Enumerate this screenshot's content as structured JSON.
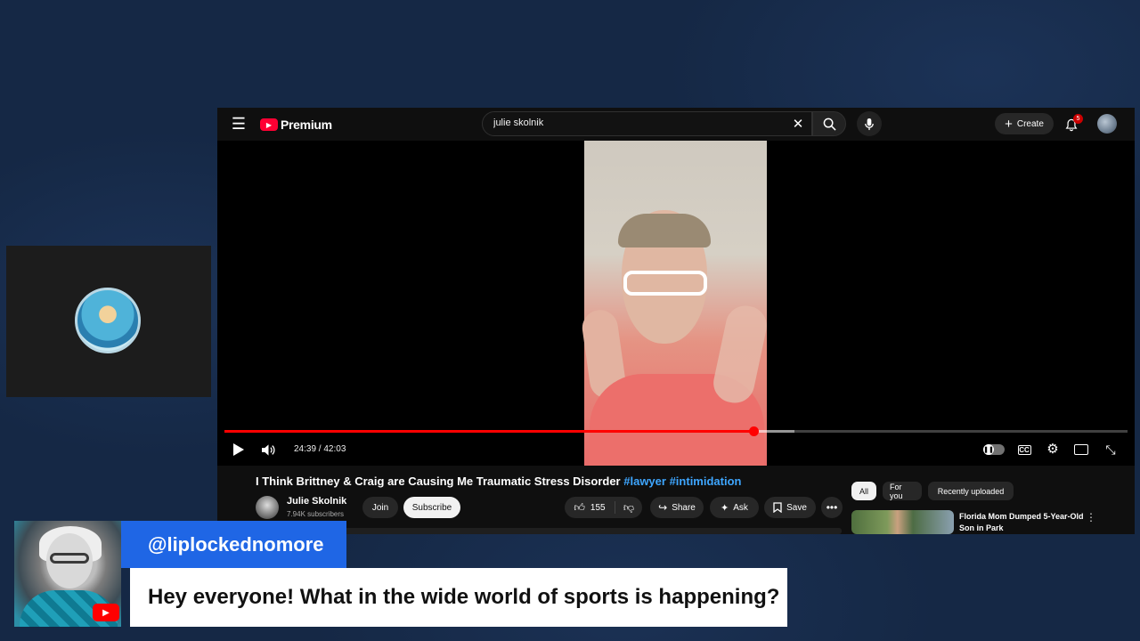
{
  "webcam_panel": {
    "avatar_icon": "channel-logo-avatar"
  },
  "youtube": {
    "logo_text": "Premium",
    "search": {
      "value": "julie skolnik",
      "placeholder": "Search"
    },
    "create_label": "Create",
    "notification_count": "5",
    "player": {
      "time_current": "24:39",
      "time_total": "42:03",
      "time_display": "24:39 / 42:03",
      "progress_fraction": 0.586,
      "buffer_fraction": 0.631
    },
    "video": {
      "title_main": "I Think Brittney & Craig are Causing Me Traumatic Stress Disorder",
      "tag1": "#lawyer",
      "tag2": "#intimidation",
      "channel_name": "Julie Skolnik",
      "subscribers": "7.94K subscribers",
      "join_label": "Join",
      "subscribe_label": "Subscribe",
      "like_count": "155",
      "share_label": "Share",
      "ask_label": "Ask",
      "save_label": "Save"
    },
    "chips": [
      "All",
      "For you",
      "Recently uploaded"
    ],
    "recommendation": {
      "title": "Florida Mom Dumped 5-Year-Old Son in Park"
    }
  },
  "chat_overlay": {
    "username": "@liplockednomore",
    "message": "Hey everyone! What in the wide world of sports is happening?",
    "platform_icon": "youtube-icon"
  },
  "colors": {
    "accent_red": "#ff0000",
    "username_bar": "#1f66e5",
    "tag_blue": "#3ea6ff"
  }
}
